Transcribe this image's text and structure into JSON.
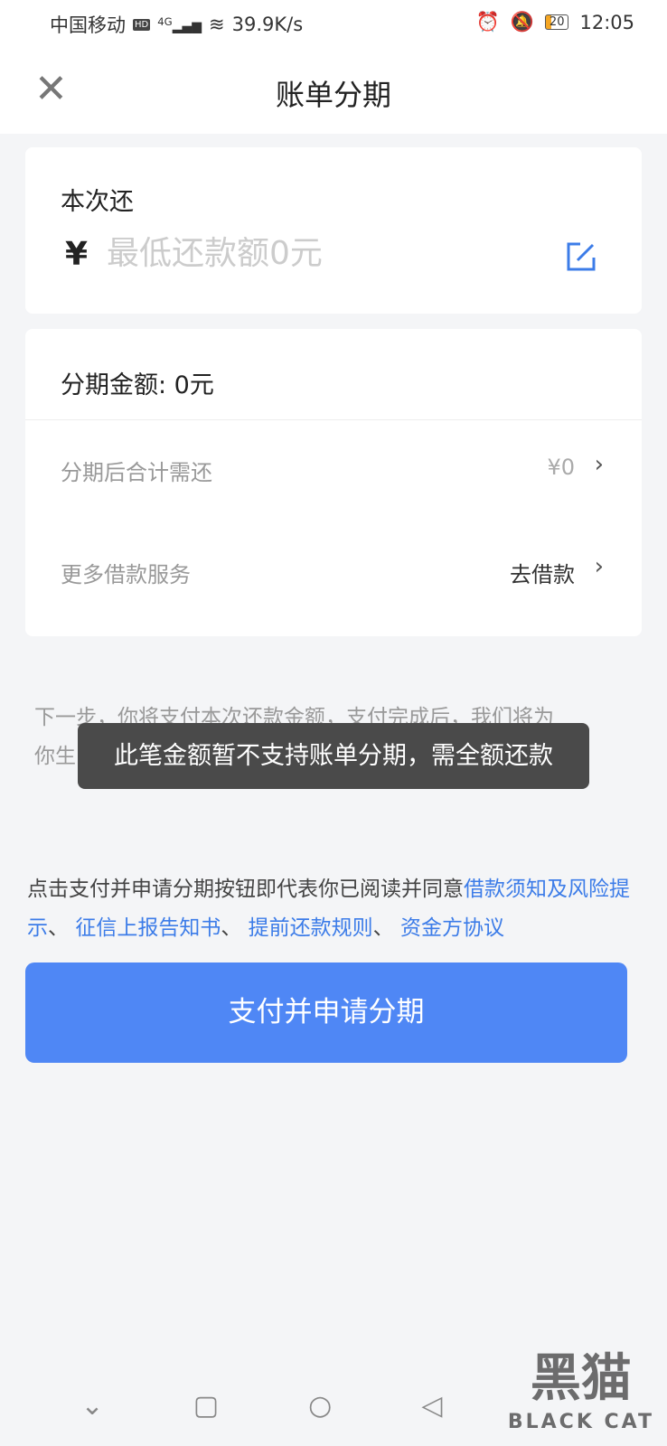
{
  "status_bar": {
    "carrier": "中国移动",
    "hd": "HD",
    "network": "4G",
    "speed": "39.9K/s",
    "battery": "20",
    "time": "12:05"
  },
  "header": {
    "title": "账单分期"
  },
  "repay": {
    "label": "本次还",
    "currency": "¥",
    "placeholder": "最低还款额0元"
  },
  "installment": {
    "amount_label": "分期金额: 0元",
    "rows": [
      {
        "label": "分期后合计需还",
        "value": "¥0"
      },
      {
        "label": "更多借款服务",
        "value": "去借款"
      }
    ]
  },
  "note": {
    "line1": "下一步，你将支付本次还款金额，支付完成后，我们将为",
    "line2": "你生"
  },
  "toast": "此笔金额暂不支持账单分期，需全额还款",
  "agreement": {
    "prefix": "点击支付并申请分期按钮即代表你已阅读并同意",
    "links": [
      "借款须知及风险提示",
      "征信上报告知书",
      "提前还款规则",
      "资金方协议"
    ],
    "sep": "、 "
  },
  "submit_label": "支付并申请分期",
  "watermark": {
    "cn": "黑猫",
    "en": "BLACK CAT"
  }
}
